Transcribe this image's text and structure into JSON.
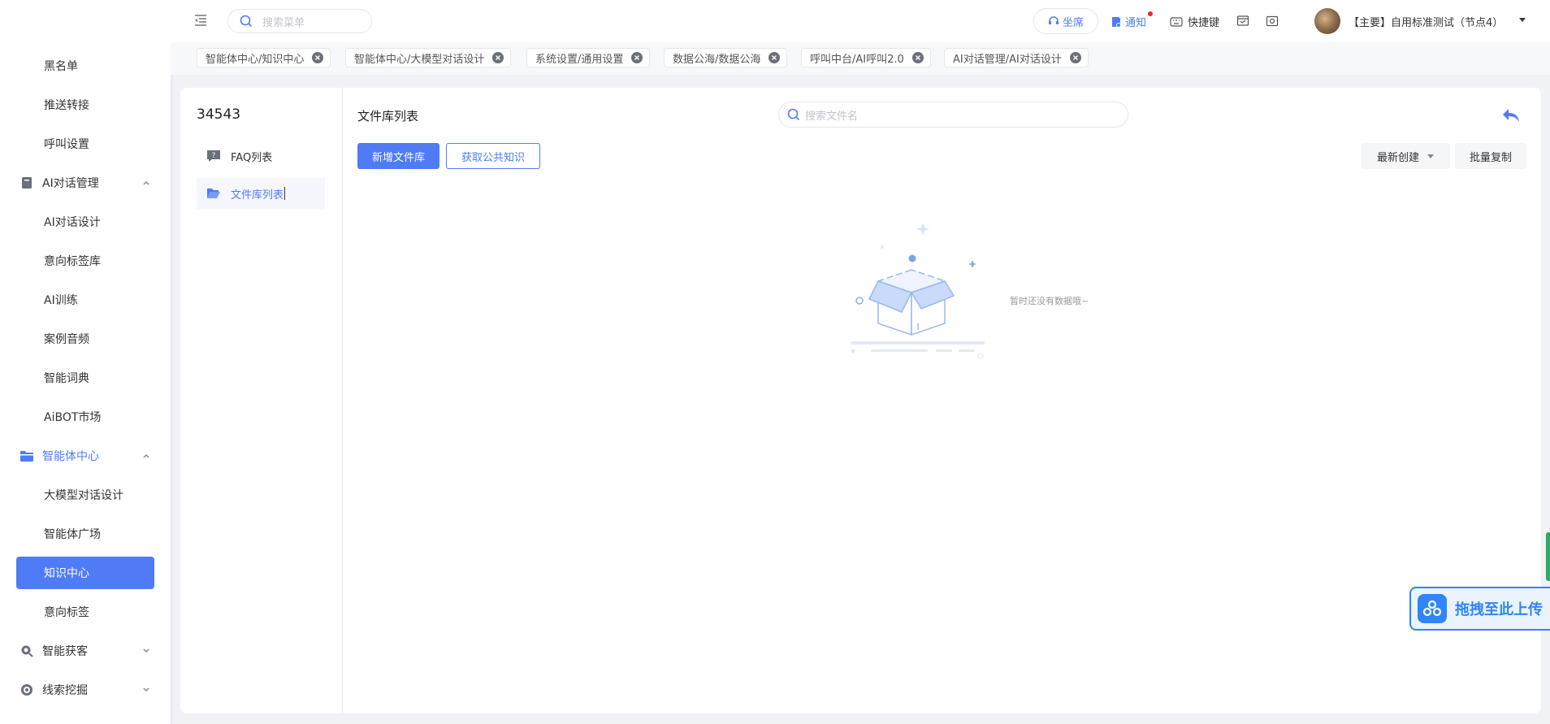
{
  "sidebar": {
    "items": [
      {
        "label": "黑名单"
      },
      {
        "label": "推送转接"
      },
      {
        "label": "呼叫设置"
      },
      {
        "label": "AI对话管理"
      },
      {
        "label": "AI对话设计"
      },
      {
        "label": "意向标签库"
      },
      {
        "label": "AI训练"
      },
      {
        "label": "案例音频"
      },
      {
        "label": "智能词典"
      },
      {
        "label": "AiBOT市场"
      },
      {
        "label": "智能体中心"
      },
      {
        "label": "大模型对话设计"
      },
      {
        "label": "智能体广场"
      },
      {
        "label": "知识中心"
      },
      {
        "label": "意向标签"
      },
      {
        "label": "智能获客"
      },
      {
        "label": "线索挖掘"
      }
    ]
  },
  "topbar": {
    "search_placeholder": "搜索菜单",
    "seat_label": "坐席",
    "notice_label": "通知",
    "shortcut_label": "快捷键",
    "user_name": "【主要】自用标准测试（节点4）"
  },
  "tabs": [
    {
      "label": "智能体中心/知识中心"
    },
    {
      "label": "智能体中心/大模型对话设计"
    },
    {
      "label": "系统设置/通用设置"
    },
    {
      "label": "数据公海/数据公海"
    },
    {
      "label": "呼叫中台/AI呼叫2.0"
    },
    {
      "label": "AI对话管理/AI对话设计"
    }
  ],
  "knowledge": {
    "name": "34543",
    "nav": [
      {
        "label": "FAQ列表"
      },
      {
        "label": "文件库列表"
      }
    ]
  },
  "filelib": {
    "title": "文件库列表",
    "search_placeholder": "搜索文件名",
    "add_label": "新增文件库",
    "fetch_label": "获取公共知识",
    "sort_label": "最新创建",
    "batch_label": "批量复制",
    "empty_text": "暂时还没有数据哦~"
  },
  "drop_widget": {
    "label": "拖拽至此上传"
  },
  "colors": {
    "accent": "#4f7bf7",
    "notice_dot": "#f5222d",
    "drop_blue": "#2f86f6"
  }
}
